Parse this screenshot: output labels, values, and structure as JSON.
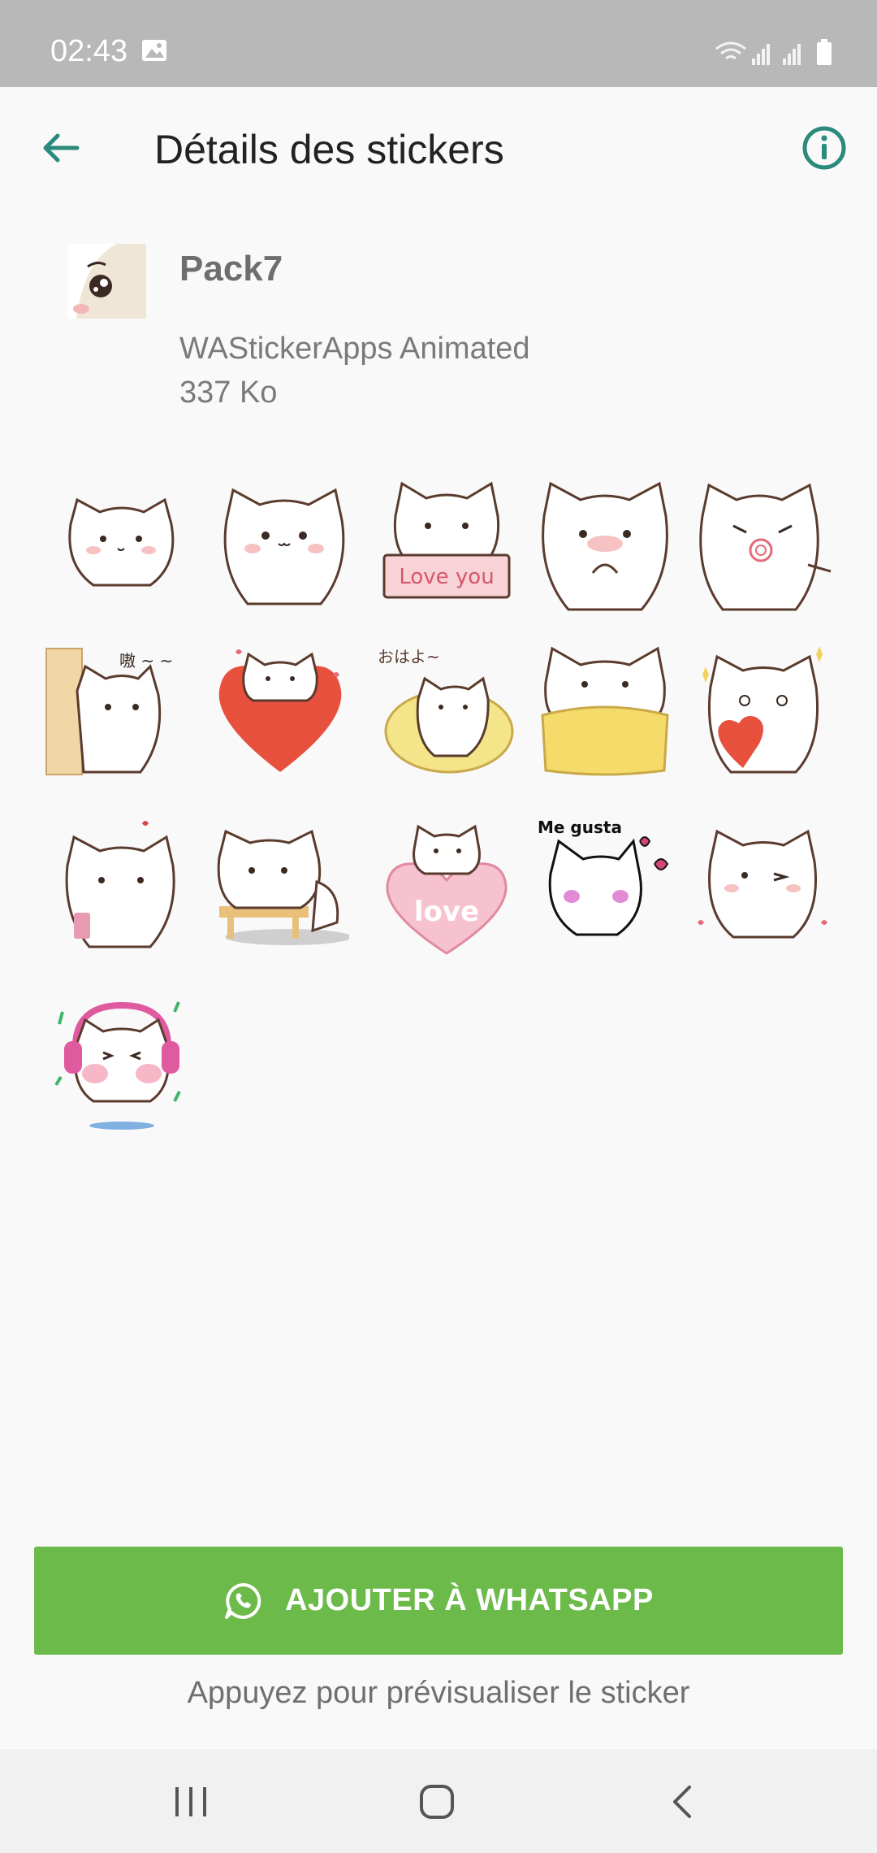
{
  "status_bar": {
    "time": "02:43",
    "icons": [
      "image-icon",
      "wifi-icon",
      "signal-icon",
      "signal-icon",
      "battery-icon"
    ]
  },
  "app_bar": {
    "title": "Détails des stickers",
    "back_icon": "arrow-left-icon",
    "info_icon": "info-icon"
  },
  "pack": {
    "name": "Pack7",
    "publisher": "WAStickerApps Animated",
    "size": "337 Ko"
  },
  "stickers": {
    "texts": [
      "Love you",
      "嗷 ~ ~",
      "おはよ~",
      "love",
      "Me gusta"
    ]
  },
  "actions": {
    "add_label": "AJOUTER À WHATSAPP",
    "hint": "Appuyez pour prévisualiser le sticker"
  },
  "colors": {
    "accent": "#2a8a7c",
    "add_button": "#6cbb4a"
  }
}
